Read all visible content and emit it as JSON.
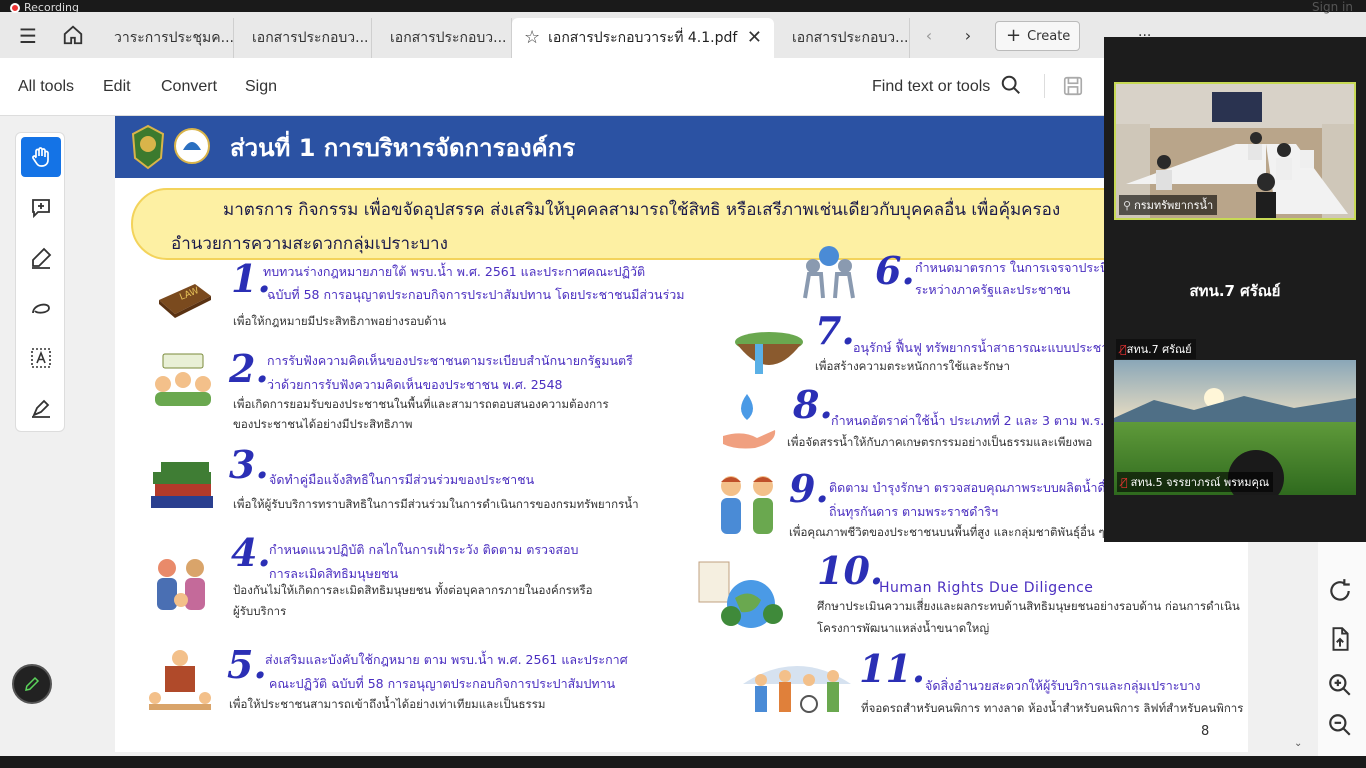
{
  "recording_label": "Recording",
  "signin_label": "Sign in",
  "tabs": [
    {
      "label": "วาระการประชุมค..."
    },
    {
      "label": "เอกสารประกอบว..."
    },
    {
      "label": "เอกสารประกอบว..."
    },
    {
      "label": "เอกสารประกอบวาระที่ 4.1.pdf",
      "active": true
    },
    {
      "label": "เอกสารประกอบว..."
    }
  ],
  "create_label": "Create",
  "toolbar": {
    "menu": [
      "All tools",
      "Edit",
      "Convert",
      "Sign"
    ],
    "find_label": "Find text or tools"
  },
  "left_tools": [
    "hand-tool",
    "add-comment",
    "highlight",
    "draw",
    "text-select",
    "fill-sign"
  ],
  "document": {
    "section_title": "ส่วนที่ 1 การบริหารจัดการองค์กร",
    "banner_line1": "มาตรการ กิจกรรม เพื่อขจัดอุปสรรค ส่งเสริมให้บุคคลสามารถใช้สิทธิ หรือเสรีภาพเช่นเดียวกับบุคคลอื่น เพื่อคุ้มครอง",
    "banner_line2": "อำนวยการความสะดวกกลุ่มเปราะบาง",
    "page_number": "8",
    "items": [
      {
        "num": "1.",
        "head1": "ทบทวนร่างกฎหมายภายใต้ พรบ.น้ำ พ.ศ. 2561 และประกาศคณะปฏิวัติ",
        "head2": "ฉบับที่ 58 การอนุญาตประกอบกิจการประปาสัมปทาน โดยประชาชนมีส่วนร่วม",
        "desc1": "เพื่อให้กฎหมายมีประสิทธิภาพอย่างรอบด้าน",
        "desc2": ""
      },
      {
        "num": "2.",
        "head1": "การรับฟังความคิดเห็นของประชาชนตามระเบียบสำนักนายกรัฐมนตรี",
        "head2": "ว่าด้วยการรับฟังความคิดเห็นของประชาชน พ.ศ. 2548",
        "desc1": "เพื่อเกิดการยอมรับของประชาชนในพื้นที่และสามารถตอบสนองความต้องการ",
        "desc2": "ของประชาชนได้อย่างมีประสิทธิภาพ"
      },
      {
        "num": "3.",
        "head1": "จัดทำคู่มือแจ้งสิทธิในการมีส่วนร่วมของประชาชน",
        "head2": "",
        "desc1": "เพื่อให้ผู้รับบริการทราบสิทธิในการมีส่วนร่วมในการดำเนินการของกรมทรัพยากรน้ำ",
        "desc2": ""
      },
      {
        "num": "4.",
        "head1": "กำหนดแนวปฏิบัติ กลไกในการเฝ้าระวัง ติดตาม ตรวจสอบ",
        "head2": "การละเมิดสิทธิมนุษยชน",
        "desc1": "ป้องกันไม่ให้เกิดการละเมิดสิทธิมนุษยชน ทั้งต่อบุคลากรภายในองค์กรหรือ",
        "desc2": "ผู้รับบริการ"
      },
      {
        "num": "5.",
        "head1": "ส่งเสริมและบังคับใช้กฎหมาย ตาม พรบ.น้ำ พ.ศ. 2561 และประกาศ",
        "head2": "คณะปฏิวัติ ฉบับที่ 58 การอนุญาตประกอบกิจการประปาสัมปทาน",
        "desc1": "เพื่อให้ประชาชนสามารถเข้าถึงน้ำได้อย่างเท่าเทียมและเป็นธรรม",
        "desc2": ""
      },
      {
        "num": "6.",
        "head1": "กำหนดมาตรการ ในการเจรจาประนีป",
        "head2": "ระหว่างภาครัฐและประชาชน",
        "desc1": "",
        "desc2": ""
      },
      {
        "num": "7.",
        "head1": "อนุรักษ์ ฟื้นฟู ทรัพยากรน้ำสาธารณะแบบประชา",
        "head2": "",
        "desc1": "เพื่อสร้างความตระหนักการใช้และรักษา",
        "desc2": ""
      },
      {
        "num": "8.",
        "head1": "กำหนดอัตราค่าใช้น้ำ ประเภทที่ 2 และ 3 ตาม พ.ร.บ. น",
        "head2": "",
        "desc1": "เพื่อจัดสรรน้ำให้กับภาคเกษตรกรรมอย่างเป็นธรรมและเพียงพอ",
        "desc2": ""
      },
      {
        "num": "9.",
        "head1": "ติดตาม บำรุงรักษา ตรวจสอบคุณภาพระบบผลิตน้ำดื่ม",
        "head2": "ถิ่นทุรกันดาร ตามพระราชดำริฯ",
        "desc1": "เพื่อคุณภาพชีวิตของประชาชนบนพื้นที่สูง และกลุ่มชาติพันธุ์อื่น ๆ",
        "desc2": ""
      },
      {
        "num": "10.",
        "head1": "Human Rights Due Diligence",
        "head2": "",
        "desc1": "ศึกษาประเมินความเสี่ยงและผลกระทบด้านสิทธิมนุษยชนอย่างรอบด้าน ก่อนการดำเนิน",
        "desc2": "โครงการพัฒนาแหล่งน้ำขนาดใหญ่"
      },
      {
        "num": "11.",
        "head1": "จัดสิ่งอำนวยสะดวกให้ผู้รับบริการและกลุ่มเปราะบาง",
        "head2": "",
        "desc1": "ที่จอดรถสำหรับคนพิการ ทางลาด ห้องน้ำสำหรับคนพิการ  ลิฟท์สำหรับคนพิการ",
        "desc2": ""
      }
    ]
  },
  "video": {
    "tile1_name": "กรมทรัพยากรน้ำ",
    "big_name": "สทน.7 ศรัณย์",
    "tile_small_name": "สทน.7 ศรัณย์",
    "tile2_name": "สทน.5 จรรยาภรณ์ พรหมคุณ"
  },
  "colors": {
    "accent": "#1473e6",
    "header_band": "#2b52a3",
    "banner": "#fdf0a3",
    "item_number": "#2b2fb5",
    "item_heading": "#4a2ec0"
  }
}
